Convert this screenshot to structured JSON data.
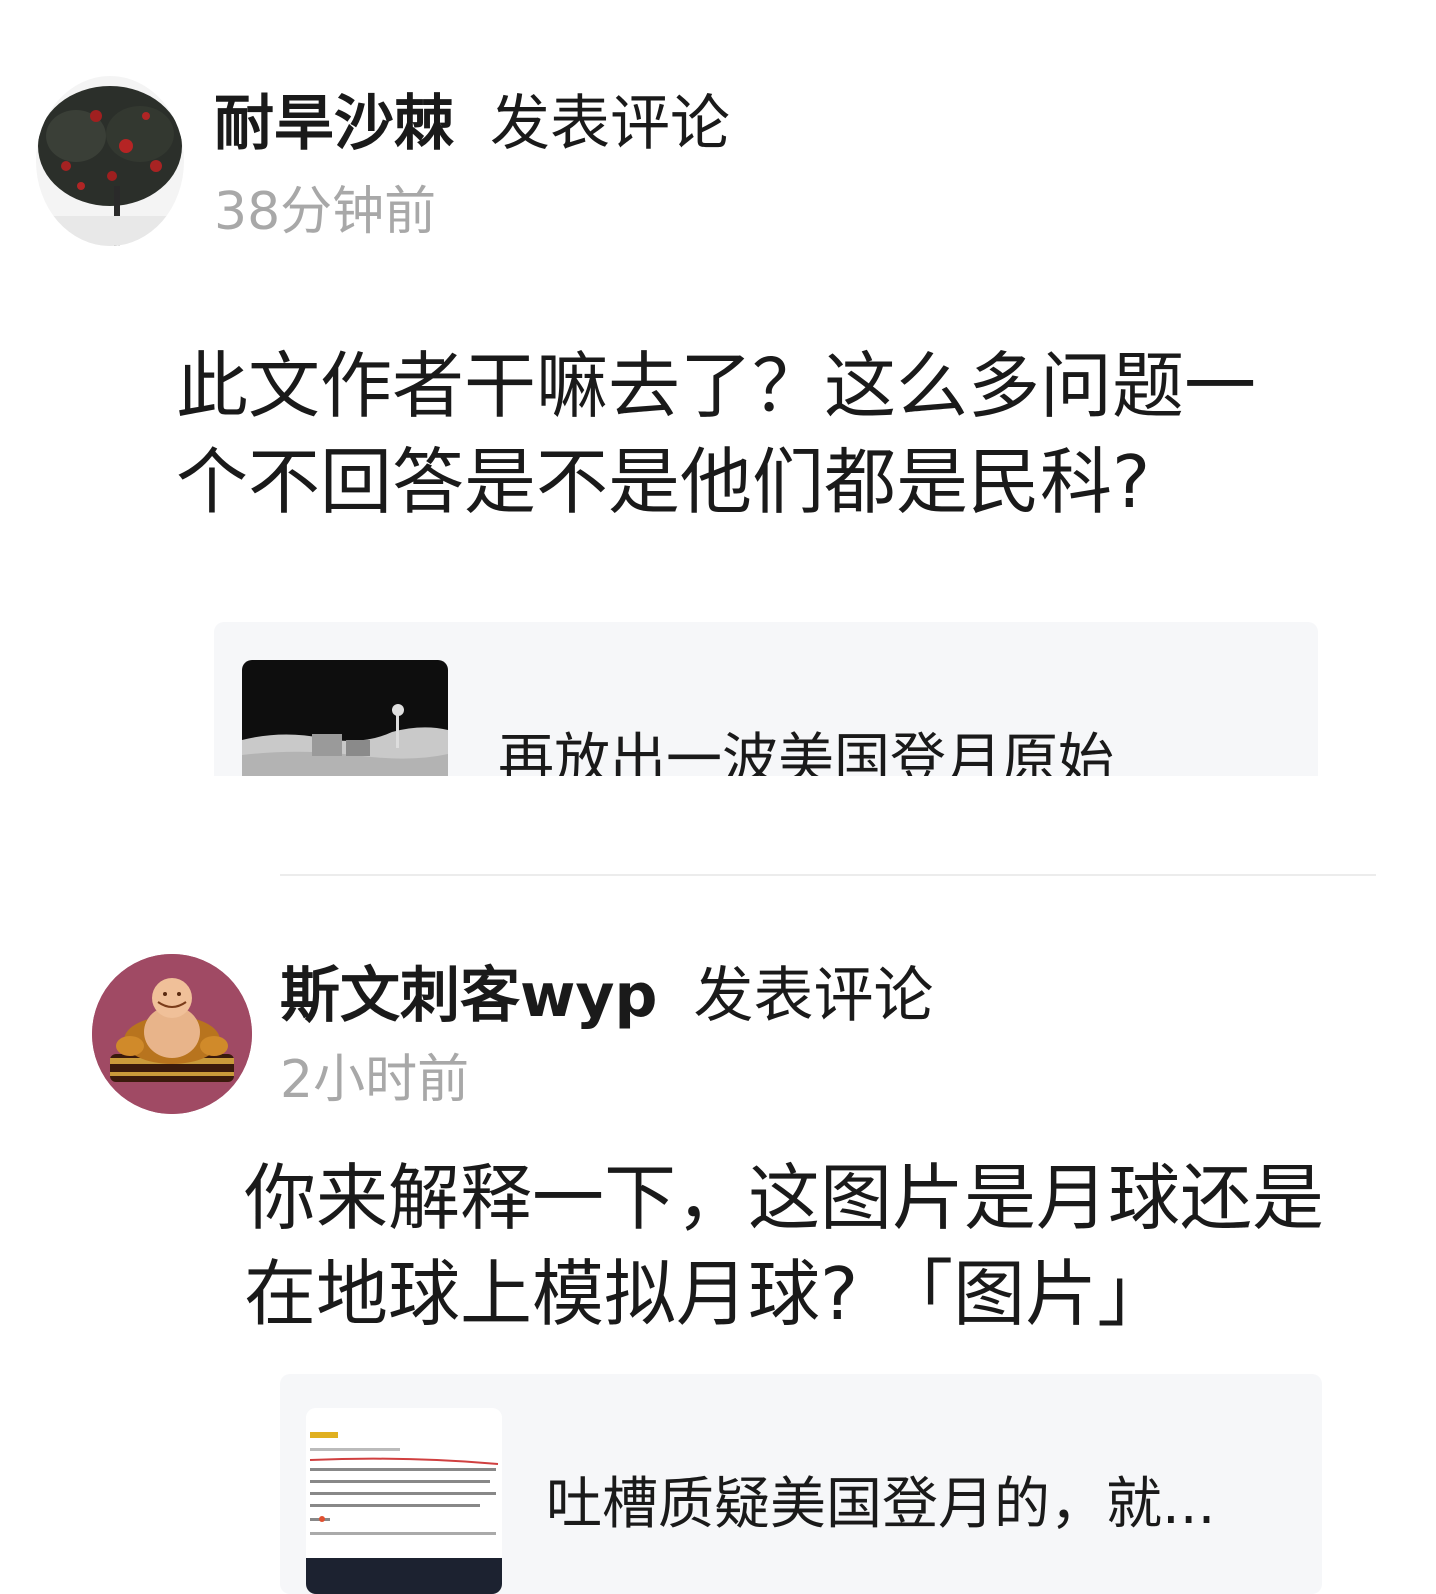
{
  "comments": [
    {
      "author": "耐旱沙棘",
      "action": "发表评论",
      "time": "38分钟前",
      "avatar_icon": "tree-avatar-icon",
      "text": "此文作者干嘛去了？这么多问题一个不回答是不是他们都是民科?",
      "card": {
        "title": "再放出一波美国登月原始",
        "thumb_icon": "moon-surface-thumbnail"
      }
    },
    {
      "author": "斯文刺客wyp",
      "action": "发表评论",
      "time": "2小时前",
      "avatar_icon": "buddha-avatar-icon",
      "text": "你来解释一下，这图片是月球还是在地球上模拟月球? 「图片」",
      "card": {
        "title": "吐槽质疑美国登月的，就...",
        "thumb_icon": "article-screenshot-thumbnail"
      }
    }
  ]
}
